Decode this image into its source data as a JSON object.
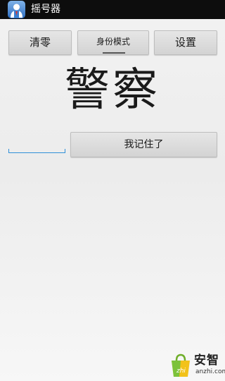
{
  "titlebar": {
    "app_title": "摇号器"
  },
  "toolbar": {
    "clear_label": "清零",
    "mode_label": "身份模式",
    "settings_label": "设置"
  },
  "main": {
    "word": "警察",
    "input_value": "",
    "remember_label": "我记住了"
  },
  "watermark": {
    "brand": "安智",
    "url": "anzhi.com"
  },
  "colors": {
    "titlebar_bg": "#0d0d0d",
    "input_underline": "#2f8fd8",
    "button_bg": "#dcdcdc"
  }
}
